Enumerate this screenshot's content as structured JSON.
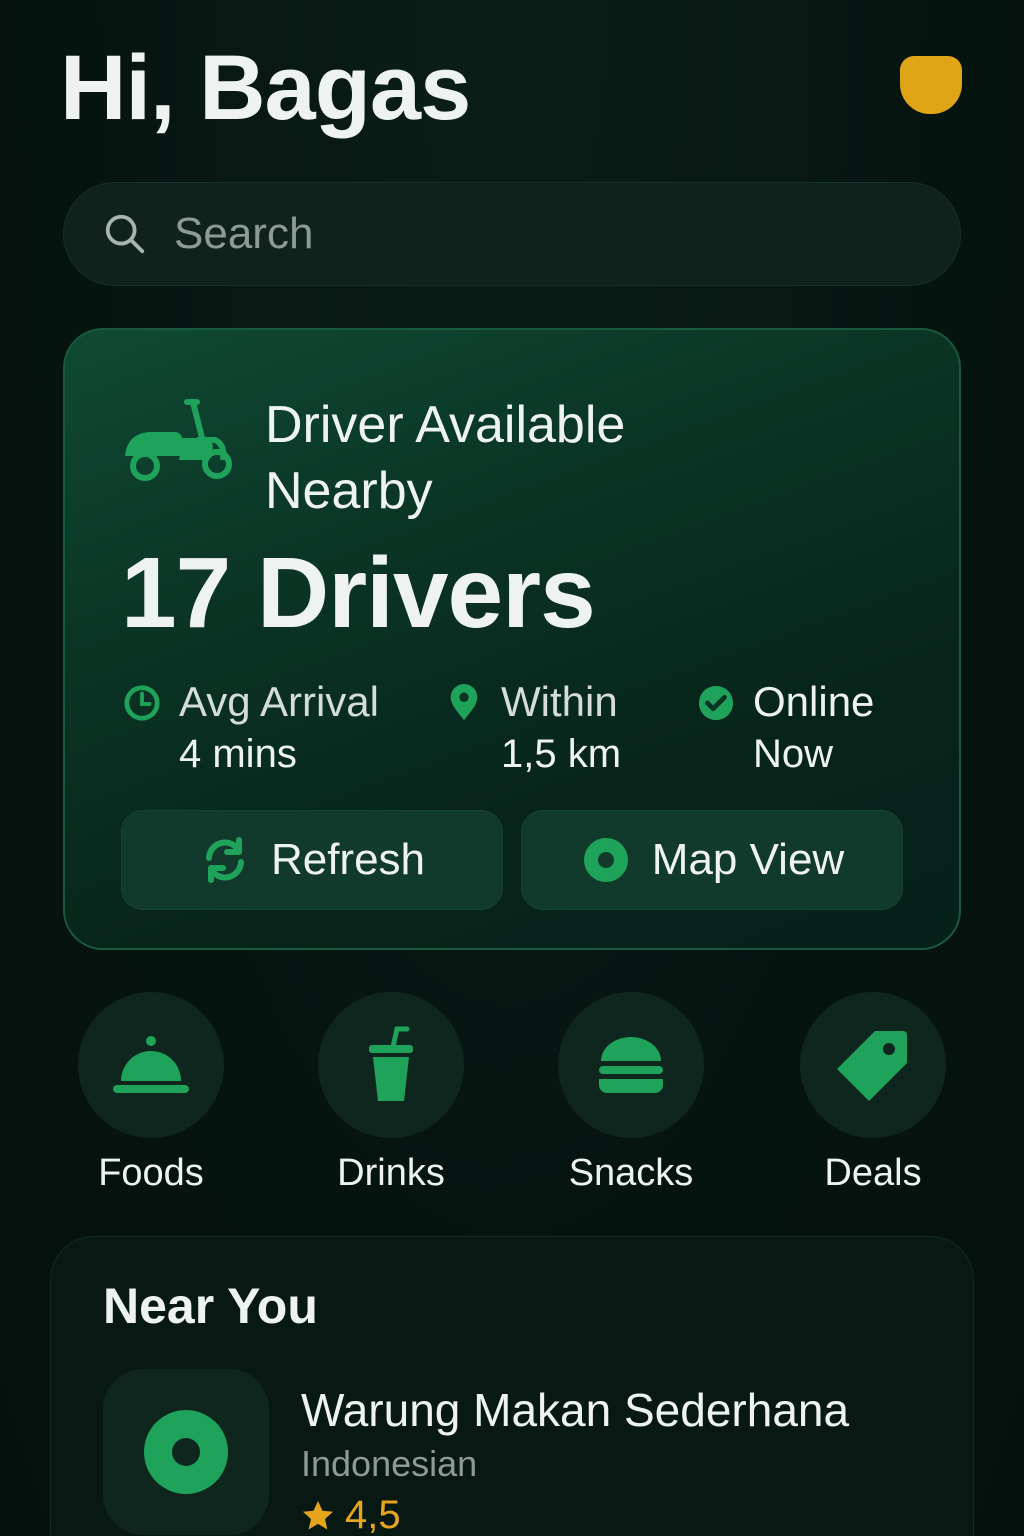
{
  "header": {
    "greeting": "Hi, Bagas"
  },
  "search": {
    "placeholder": "Search",
    "icon": "search-icon"
  },
  "driver_card": {
    "title_line1": "Driver Available",
    "title_line2": "Nearby",
    "count": "17 Drivers",
    "stats": [
      {
        "icon": "clock-icon",
        "label": "Avg Arrival",
        "value": "4 mins"
      },
      {
        "icon": "location-pin-icon",
        "label": "Within",
        "value": "1,5 km"
      },
      {
        "icon": "check-circle-icon",
        "label": "Online",
        "value": "Now"
      }
    ],
    "buttons": {
      "refresh": "Refresh",
      "map_view": "Map View"
    }
  },
  "categories": [
    {
      "icon": "food-cloche-icon",
      "label": "Foods"
    },
    {
      "icon": "drink-cup-icon",
      "label": "Drinks"
    },
    {
      "icon": "burger-icon",
      "label": "Snacks"
    },
    {
      "icon": "tag-icon",
      "label": "Deals"
    }
  ],
  "near_you": {
    "title": "Near You",
    "items": [
      {
        "name": "Warung Makan Sederhana",
        "cuisine": "Indonesian",
        "rating": "4,5"
      }
    ]
  },
  "colors": {
    "accent": "#1fa25a",
    "avatar": "#e0a516",
    "rating": "#e6a51c",
    "background": "#071611"
  }
}
